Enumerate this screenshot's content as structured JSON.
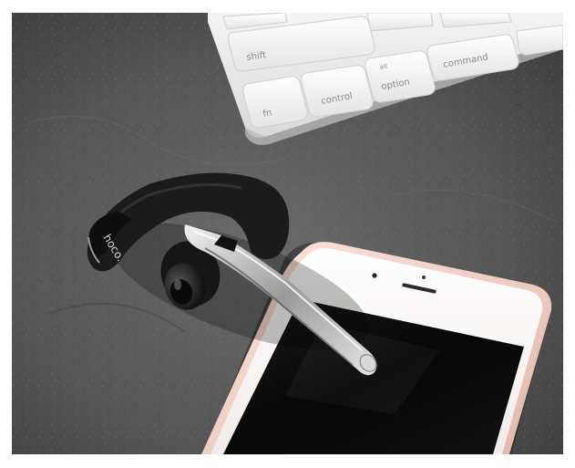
{
  "photo": {
    "subject": "Bluetooth headset resting beside a smartphone on a stone surface, keyboard in the corner",
    "keyboard_keys": [
      {
        "label": "shift"
      },
      {
        "label": "fn"
      },
      {
        "label": "control"
      },
      {
        "label": "alt"
      },
      {
        "label": "option"
      },
      {
        "label": "command"
      }
    ],
    "headset_brand": "hoco.",
    "colors": {
      "frame_border": "#ffffff",
      "stone": "#5e5e5e",
      "keyboard": "#ececec",
      "headset": "#1a1a1a",
      "chrome": "#cfcfcf",
      "phone_frame": "#f3d9cf",
      "phone_screen": "#0b0b0b"
    }
  }
}
